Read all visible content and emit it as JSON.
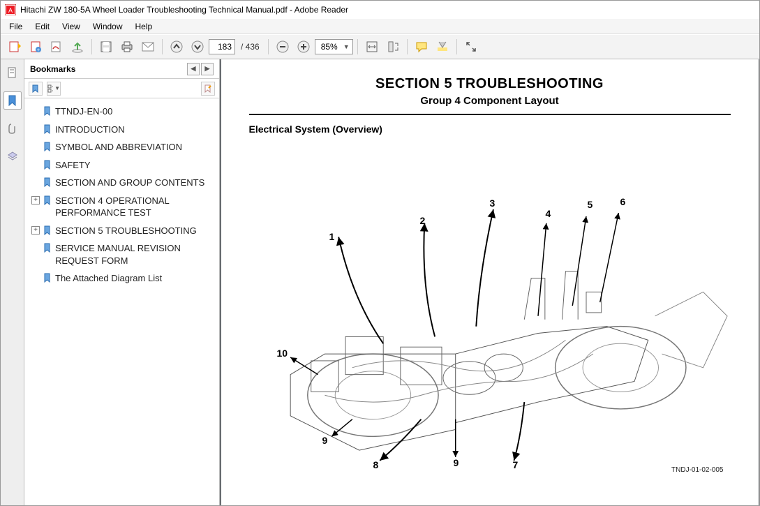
{
  "window": {
    "title": "Hitachi ZW 180-5A Wheel Loader Troubleshooting Technical Manual.pdf - Adobe Reader"
  },
  "menu": [
    "File",
    "Edit",
    "View",
    "Window",
    "Help"
  ],
  "toolbar": {
    "page_current": "183",
    "page_total": "/ 436",
    "zoom": "85%"
  },
  "panel": {
    "title": "Bookmarks"
  },
  "bookmarks": [
    {
      "label": "TTNDJ-EN-00",
      "expand": false
    },
    {
      "label": "INTRODUCTION",
      "expand": false
    },
    {
      "label": "SYMBOL AND ABBREVIATION",
      "expand": false
    },
    {
      "label": "SAFETY",
      "expand": false
    },
    {
      "label": "SECTION AND GROUP CONTENTS",
      "expand": false
    },
    {
      "label": "SECTION 4 OPERATIONAL PERFORMANCE TEST",
      "expand": true
    },
    {
      "label": "SECTION 5 TROUBLESHOOTING",
      "expand": true
    },
    {
      "label": "SERVICE MANUAL REVISION REQUEST FORM",
      "expand": false
    },
    {
      "label": "The Attached Diagram List",
      "expand": false
    }
  ],
  "document": {
    "section_title": "SECTION 5 TROUBLESHOOTING",
    "group_title": "Group 4 Component Layout",
    "subheading": "Electrical System (Overview)",
    "figure_ref": "TNDJ-01-02-005",
    "callouts": [
      "1",
      "2",
      "3",
      "4",
      "5",
      "6",
      "7",
      "8",
      "9",
      "9",
      "10"
    ]
  }
}
